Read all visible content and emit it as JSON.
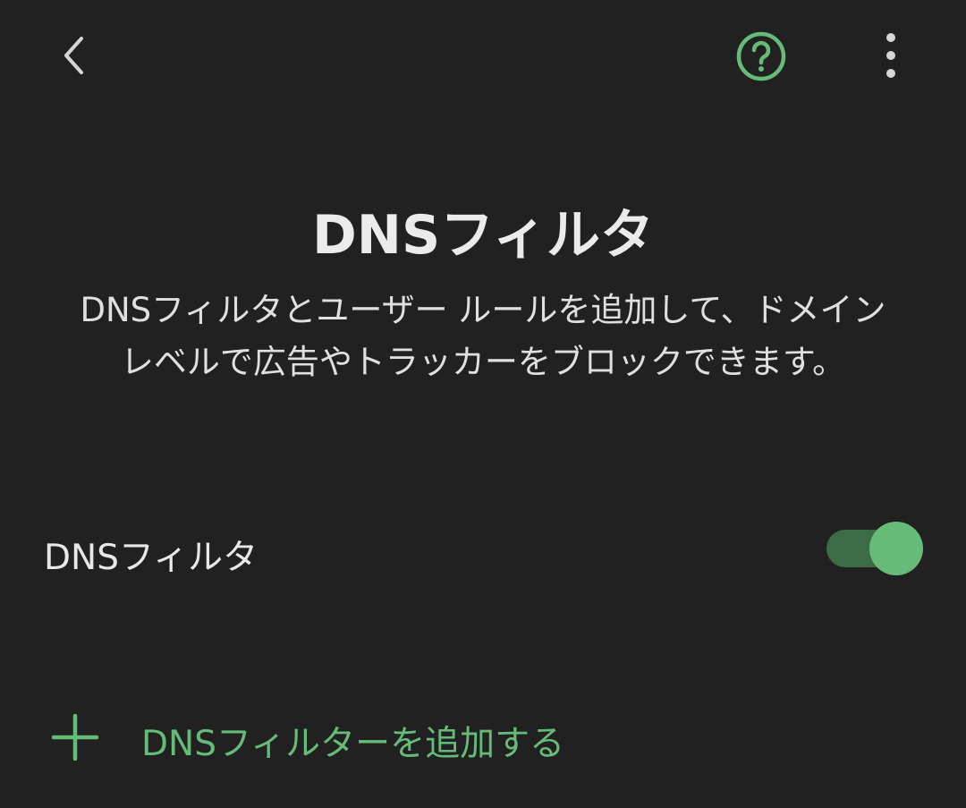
{
  "header": {
    "back_icon": "chevron-left-icon",
    "help_icon": "question-circle-icon",
    "menu_icon": "more-vertical-icon"
  },
  "main": {
    "title": "DNSフィルタ",
    "description": "DNSフィルタとユーザー ルールを追加して、ドメインレベルで広告やトラッカーをブロックできます。"
  },
  "setting": {
    "label": "DNSフィルタ",
    "enabled": true
  },
  "add_filter": {
    "label": "DNSフィルターを追加する",
    "icon": "plus-icon"
  },
  "colors": {
    "background": "#212121",
    "accent": "#67bb78",
    "toggle_track": "#3d6b46",
    "text": "#e8e8e8"
  }
}
